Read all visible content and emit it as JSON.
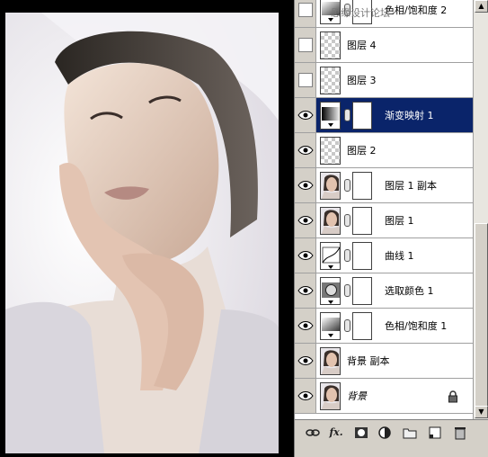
{
  "watermark": "思缘设计论坛",
  "layers": [
    {
      "name": "色相/饱和度 2",
      "visible": false,
      "thumb": "adjust-hue",
      "mask": true,
      "selected": false
    },
    {
      "name": "图层 4",
      "visible": false,
      "thumb": "transparent",
      "mask": false,
      "selected": false
    },
    {
      "name": "图层 3",
      "visible": false,
      "thumb": "transparent",
      "mask": false,
      "selected": false
    },
    {
      "name": "渐变映射 1",
      "visible": true,
      "thumb": "gradient-map",
      "mask": true,
      "selected": true
    },
    {
      "name": "图层 2",
      "visible": true,
      "thumb": "transparent",
      "mask": false,
      "selected": false
    },
    {
      "name": "图层 1 副本",
      "visible": true,
      "thumb": "photo",
      "mask": true,
      "selected": false
    },
    {
      "name": "图层 1",
      "visible": true,
      "thumb": "photo",
      "mask": true,
      "selected": false
    },
    {
      "name": "曲线 1",
      "visible": true,
      "thumb": "curves",
      "mask": true,
      "selected": false
    },
    {
      "name": "选取颜色 1",
      "visible": true,
      "thumb": "selective-color",
      "mask": true,
      "selected": false
    },
    {
      "name": "色相/饱和度 1",
      "visible": true,
      "thumb": "adjust-hue",
      "mask": true,
      "selected": false
    },
    {
      "name": "背景 副本",
      "visible": true,
      "thumb": "photo",
      "mask": false,
      "selected": false
    },
    {
      "name": "背景",
      "visible": true,
      "thumb": "photo",
      "mask": false,
      "selected": false,
      "locked": true
    }
  ],
  "toolbar": {
    "icons": [
      "link-layers-icon",
      "fx-icon",
      "add-mask-icon",
      "adjustment-layer-icon",
      "group-icon",
      "new-layer-icon",
      "delete-layer-icon"
    ],
    "fx_label": "fx."
  }
}
